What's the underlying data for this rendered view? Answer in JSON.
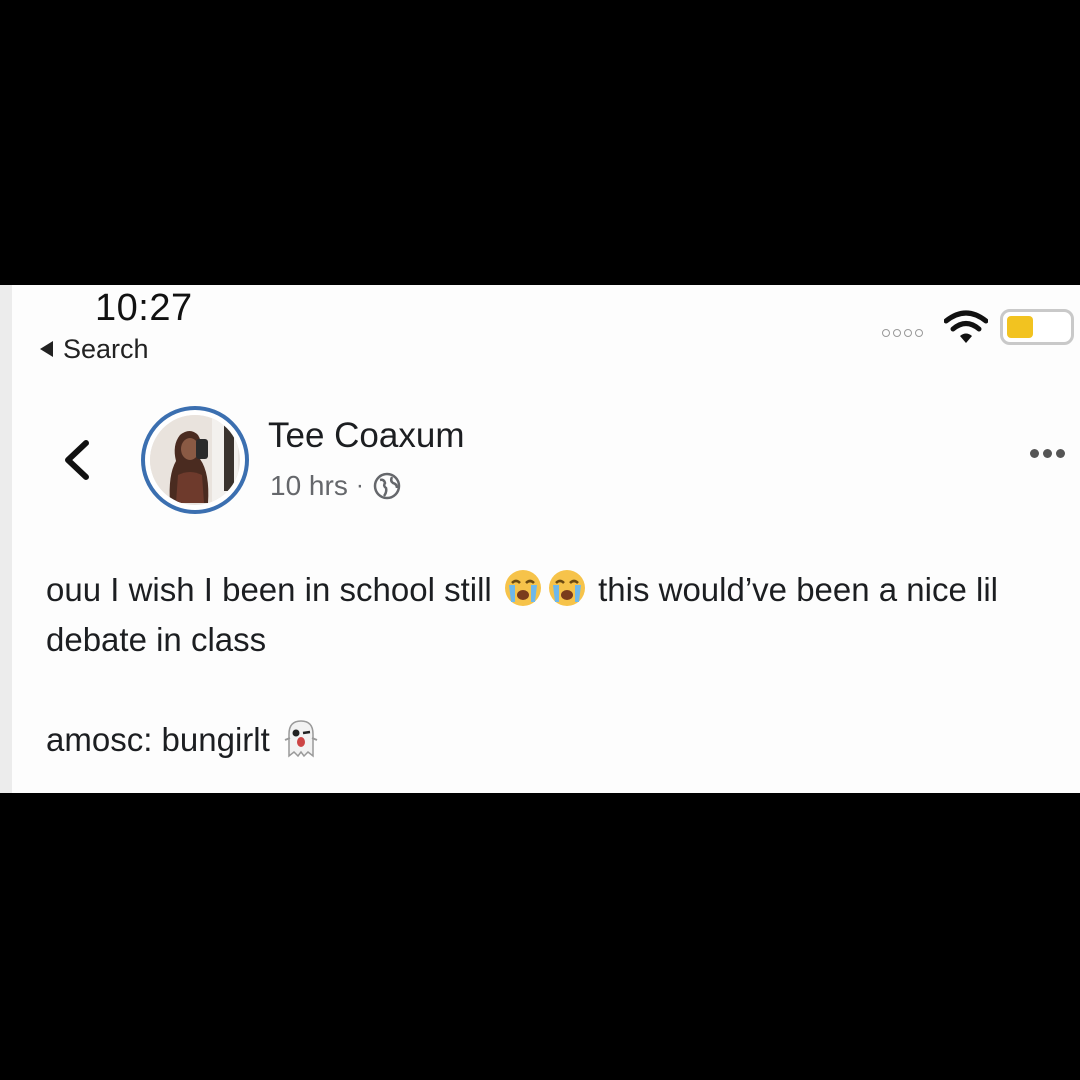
{
  "status_bar": {
    "time": "10:27",
    "back_label": "Search"
  },
  "post": {
    "author": "Tee Coaxum",
    "age": "10 hrs",
    "separator": "·",
    "visibility_icon": "globe-icon",
    "text_before_emoji": "ouu I wish I been in school still",
    "emoji_1": "loudly-crying-face",
    "emoji_2": "loudly-crying-face",
    "text_after_emoji": "this would’ve been a nice lil debate in class",
    "snapchat_line": "amosc: bungirlt",
    "snapchat_emoji": "ghost"
  },
  "colors": {
    "avatar_ring": "#3b6fb0",
    "battery_fill": "#f2c320",
    "meta_text": "#65676b"
  }
}
